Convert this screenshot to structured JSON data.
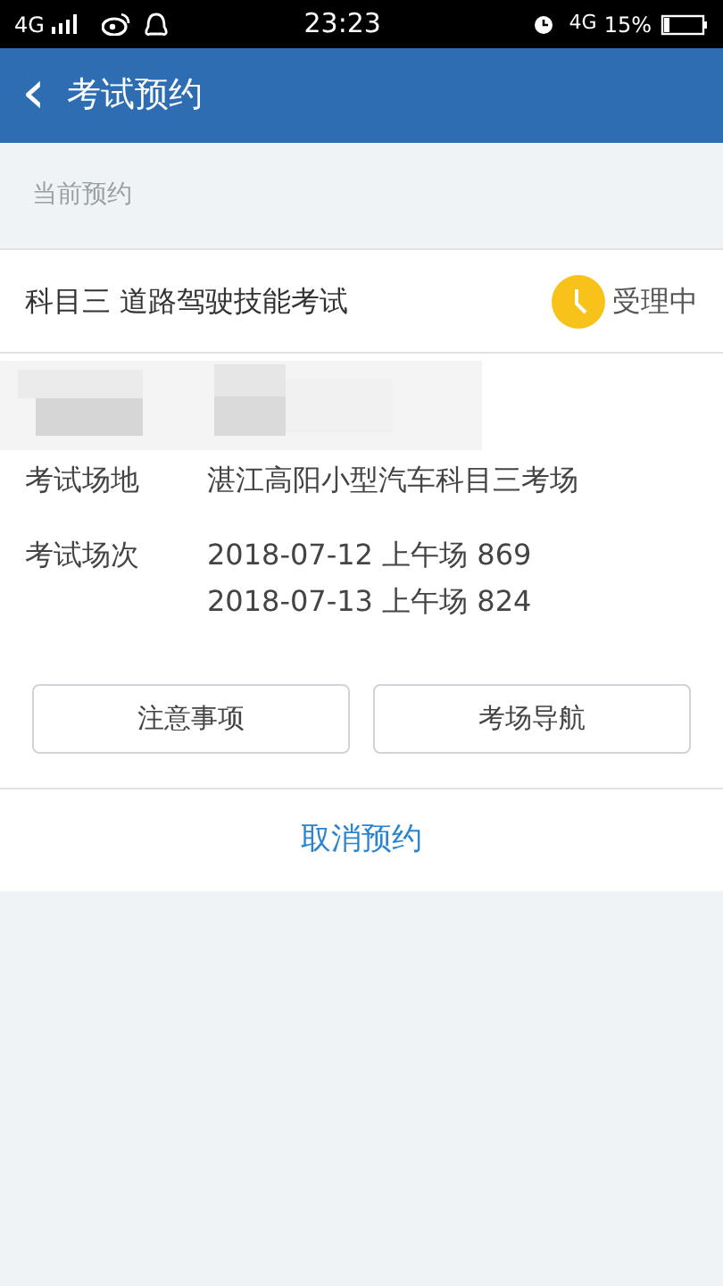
{
  "status_bar": {
    "network": "4G",
    "time": "23:23",
    "network_2": "4G",
    "battery": "15%"
  },
  "header": {
    "back": "‹",
    "title": "考试预约"
  },
  "section_label": "当前预约",
  "appointment": {
    "subject": "科目三 道路驾驶技能考试",
    "status": "受理中",
    "fields": [
      {
        "label": "考试场地",
        "values": [
          "湛江高阳小型汽车科目三考场"
        ]
      },
      {
        "label": "考试场次",
        "values": [
          "2018-07-12 上午场 869",
          "2018-07-13 上午场 824"
        ]
      }
    ],
    "buttons": [
      "注意事项",
      "考场导航"
    ],
    "cancel": "取消预约"
  }
}
